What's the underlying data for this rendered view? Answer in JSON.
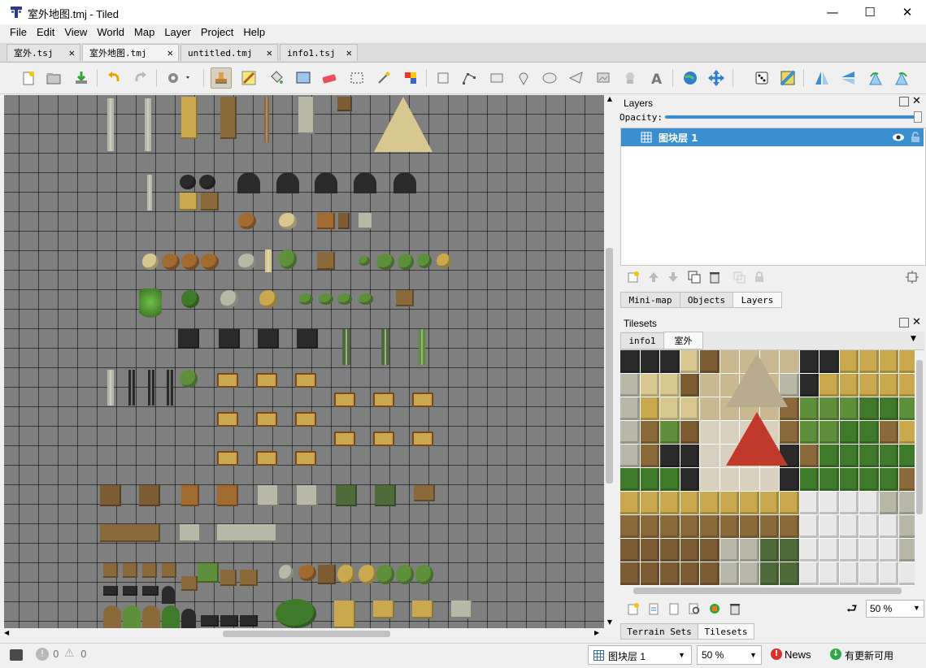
{
  "window": {
    "title": "室外地图.tmj - Tiled",
    "minimize": "—",
    "maximize": "☐",
    "close": "✕"
  },
  "menu": [
    "File",
    "Edit",
    "View",
    "World",
    "Map",
    "Layer",
    "Project",
    "Help"
  ],
  "tabs": [
    {
      "label": "室外.tsj",
      "active": false
    },
    {
      "label": "室外地图.tmj",
      "active": true
    },
    {
      "label": "untitled.tmj",
      "active": false
    },
    {
      "label": "info1.tsj",
      "active": false
    }
  ],
  "tab_close": "✕",
  "layers_panel": {
    "title": "Layers",
    "opacity_label": "Opacity:",
    "opacity": 1.0,
    "layer_name": "图块层 1"
  },
  "layers_bottom_tabs": [
    "Mini-map",
    "Objects",
    "Layers"
  ],
  "tilesets_panel": {
    "title": "Tilesets",
    "tabs": [
      "info1",
      "室外"
    ],
    "zoom": "50 %"
  },
  "bottom_tabs": [
    "Terrain Sets",
    "Tilesets"
  ],
  "status": {
    "errors": "0",
    "warnings": "0",
    "layer_combo": "图块层 1",
    "zoom": "50 %",
    "news": "News",
    "update": "有更新可用"
  },
  "colors": {
    "selection": "#3a8fd0",
    "canvas": "#7f7f7f",
    "news_red": "#d9312b",
    "update_green": "#2fa84a"
  }
}
